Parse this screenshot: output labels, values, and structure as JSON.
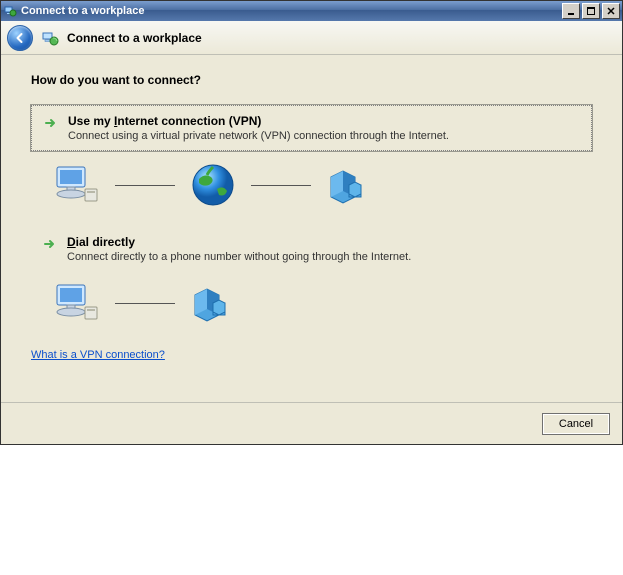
{
  "titlebar": {
    "text": "Connect to a workplace"
  },
  "nav": {
    "heading": "Connect to a workplace"
  },
  "content": {
    "question": "How do you want to connect?",
    "option_vpn": {
      "title_pre": "Use my ",
      "title_key": "I",
      "title_post": "nternet connection (VPN)",
      "desc": "Connect using a virtual private network (VPN) connection through the Internet."
    },
    "option_dial": {
      "title_pre": "",
      "title_key": "D",
      "title_post": "ial directly",
      "desc": "Connect directly to a phone number without going through the Internet."
    },
    "help_link": "What is a VPN connection?"
  },
  "footer": {
    "cancel": "Cancel"
  }
}
